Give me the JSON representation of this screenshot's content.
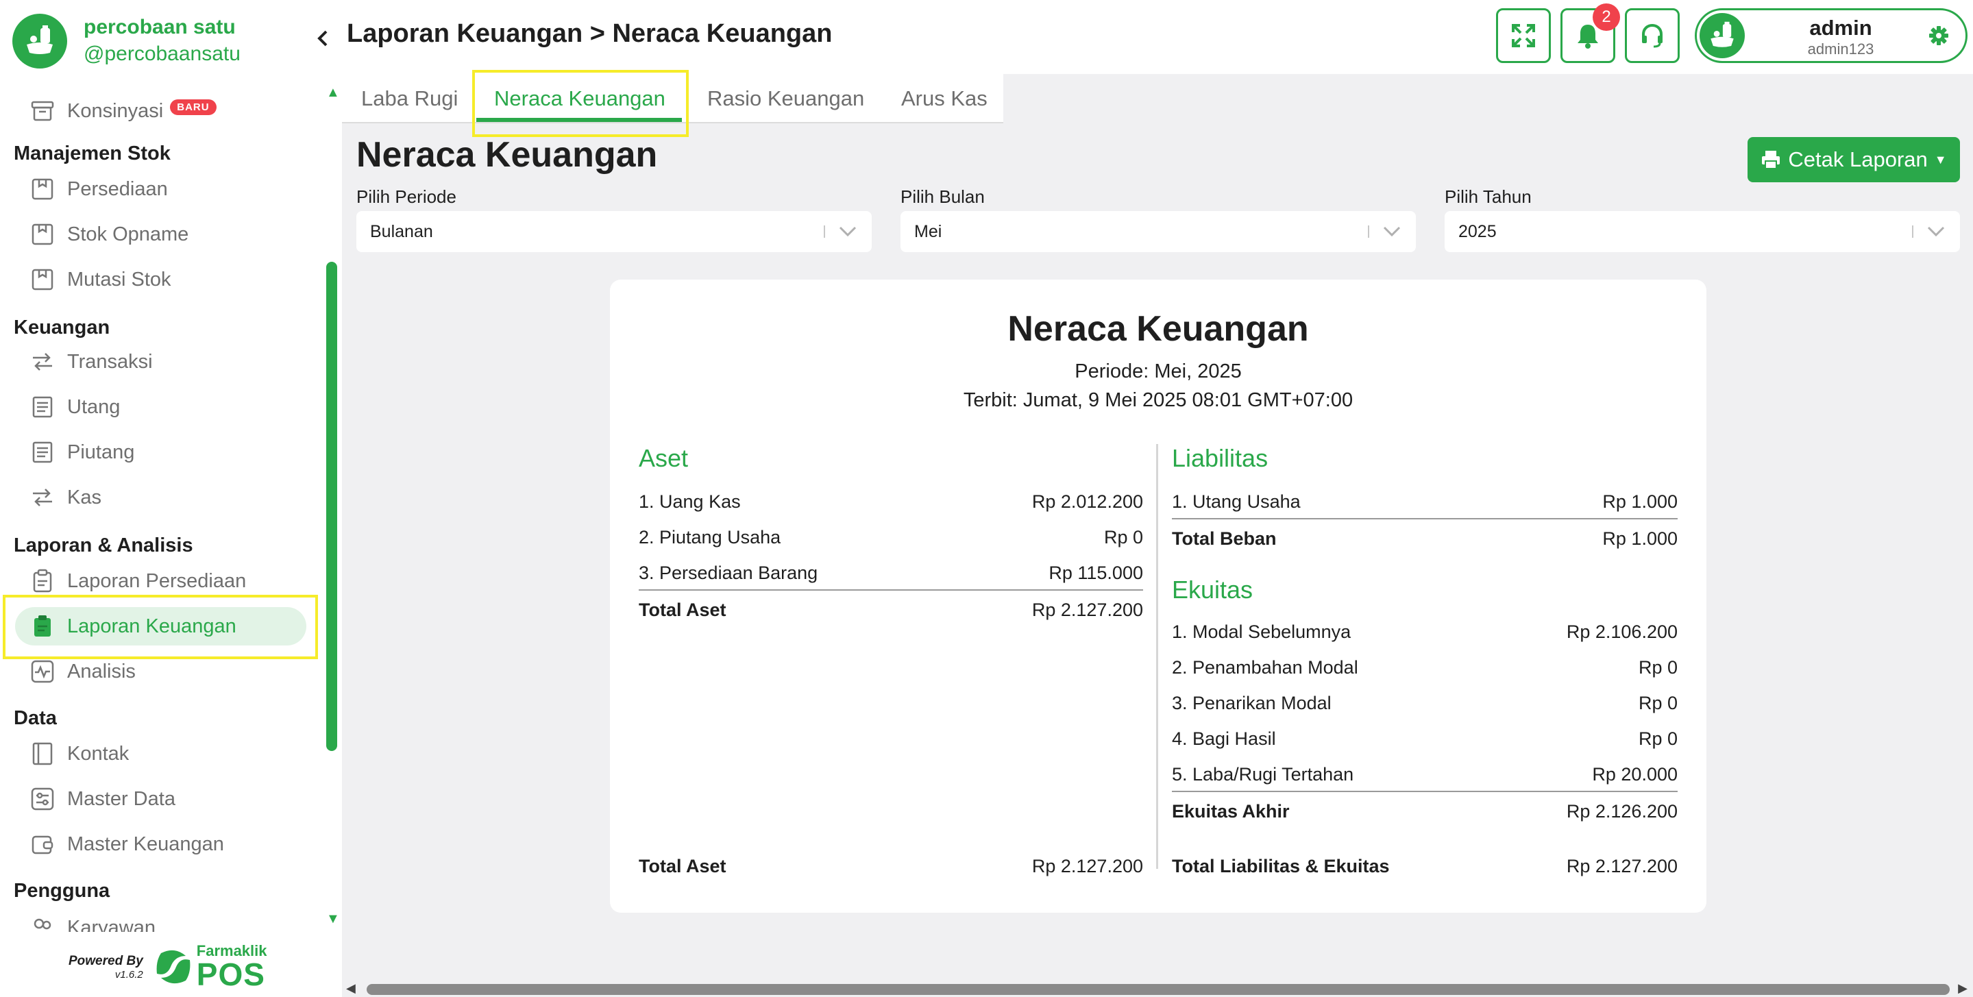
{
  "brand": {
    "name": "percobaan satu",
    "handle": "@percobaansatu"
  },
  "sidebar": {
    "items": {
      "konsinyasi": {
        "label": "Konsinyasi",
        "badge": "BARU"
      },
      "persediaan": {
        "label": "Persediaan"
      },
      "stok_opname": {
        "label": "Stok Opname"
      },
      "mutasi_stok": {
        "label": "Mutasi Stok"
      },
      "transaksi": {
        "label": "Transaksi"
      },
      "utang": {
        "label": "Utang"
      },
      "piutang": {
        "label": "Piutang"
      },
      "kas": {
        "label": "Kas"
      },
      "laporan_persediaan": {
        "label": "Laporan Persediaan"
      },
      "laporan_keuangan": {
        "label": "Laporan Keuangan"
      },
      "analisis": {
        "label": "Analisis"
      },
      "kontak": {
        "label": "Kontak"
      },
      "master_data": {
        "label": "Master Data"
      },
      "master_keuangan": {
        "label": "Master Keuangan"
      },
      "karyawan": {
        "label": "Karyawan"
      }
    },
    "sections": {
      "stok": "Manajemen Stok",
      "keuangan": "Keuangan",
      "laporan": "Laporan & Analisis",
      "data": "Data",
      "pengguna": "Pengguna"
    },
    "powered_by": "Powered By",
    "version": "v1.6.2",
    "vendor_brand": "Farmaklik",
    "vendor_product": "POS"
  },
  "header": {
    "breadcrumb": "Laporan Keuangan > Neraca Keuangan",
    "notification_count": "2",
    "user": {
      "name": "admin",
      "handle": "admin123"
    }
  },
  "tabs": [
    "Laba Rugi",
    "Neraca Keuangan",
    "Rasio Keuangan",
    "Arus Kas"
  ],
  "page": {
    "title": "Neraca Keuangan",
    "print_label": "Cetak Laporan"
  },
  "filters": {
    "periode": {
      "label": "Pilih Periode",
      "value": "Bulanan"
    },
    "bulan": {
      "label": "Pilih Bulan",
      "value": "Mei"
    },
    "tahun": {
      "label": "Pilih Tahun",
      "value": "2025"
    }
  },
  "report": {
    "title": "Neraca Keuangan",
    "period": "Periode: Mei, 2025",
    "issued": "Terbit: Jumat, 9 Mei 2025 08:01 GMT+07:00",
    "aset": {
      "heading": "Aset",
      "rows": [
        {
          "label": "1. Uang Kas",
          "amount": "Rp 2.012.200"
        },
        {
          "label": "2. Piutang Usaha",
          "amount": "Rp 0"
        },
        {
          "label": "3. Persediaan Barang",
          "amount": "Rp 115.000"
        }
      ],
      "total_label": "Total Aset",
      "total_amount": "Rp 2.127.200"
    },
    "liabilitas": {
      "heading": "Liabilitas",
      "rows": [
        {
          "label": "1. Utang Usaha",
          "amount": "Rp 1.000"
        }
      ],
      "total_label": "Total Beban",
      "total_amount": "Rp 1.000"
    },
    "ekuitas": {
      "heading": "Ekuitas",
      "rows": [
        {
          "label": "1. Modal Sebelumnya",
          "amount": "Rp 2.106.200"
        },
        {
          "label": "2. Penambahan Modal",
          "amount": "Rp 0"
        },
        {
          "label": "3. Penarikan Modal",
          "amount": "Rp 0"
        },
        {
          "label": "4. Bagi Hasil",
          "amount": "Rp 0"
        },
        {
          "label": "5. Laba/Rugi Tertahan",
          "amount": "Rp 20.000"
        }
      ],
      "total_label": "Ekuitas Akhir",
      "total_amount": "Rp 2.126.200"
    },
    "grand_left_label": "Total Aset",
    "grand_left_amount": "Rp 2.127.200",
    "grand_right_label": "Total Liabilitas & Ekuitas",
    "grand_right_amount": "Rp 2.127.200"
  },
  "colors": {
    "accent": "#2aa84a",
    "highlight": "#f6ec2a",
    "danger": "#f0424b"
  }
}
